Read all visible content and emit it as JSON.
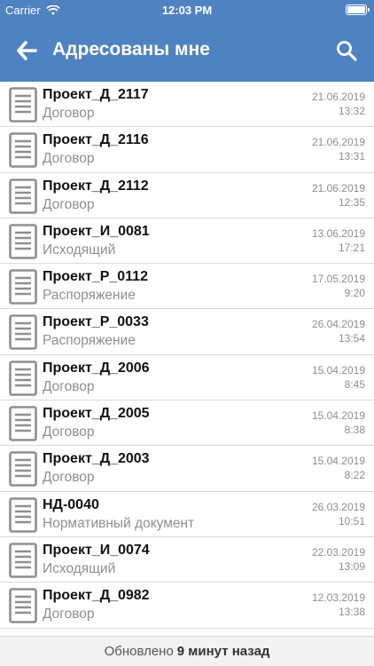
{
  "status_bar": {
    "carrier": "Carrier",
    "time": "12:03 PM",
    "wifi_icon": "wifi-icon",
    "battery_icon": "battery-icon"
  },
  "header": {
    "title": "Адресованы мне",
    "back_icon": "back-arrow-icon",
    "search_icon": "search-icon",
    "background": "#4f82c1"
  },
  "items": [
    {
      "title": "Проект_Д_2117",
      "subtitle": "Договор",
      "date": "21.06.2019",
      "time": "13:32"
    },
    {
      "title": "Проект_Д_2116",
      "subtitle": "Договор",
      "date": "21.06.2019",
      "time": "13:31"
    },
    {
      "title": "Проект_Д_2112",
      "subtitle": "Договор",
      "date": "21.06.2019",
      "time": "12:35"
    },
    {
      "title": "Проект_И_0081",
      "subtitle": "Исходящий",
      "date": "13.06.2019",
      "time": "17:21"
    },
    {
      "title": "Проект_Р_0112",
      "subtitle": "Распоряжение",
      "date": "17.05.2019",
      "time": "9:20"
    },
    {
      "title": "Проект_Р_0033",
      "subtitle": "Распоряжение",
      "date": "26.04.2019",
      "time": "13:54"
    },
    {
      "title": "Проект_Д_2006",
      "subtitle": "Договор",
      "date": "15.04.2019",
      "time": "8:45"
    },
    {
      "title": "Проект_Д_2005",
      "subtitle": "Договор",
      "date": "15.04.2019",
      "time": "8:38"
    },
    {
      "title": "Проект_Д_2003",
      "subtitle": "Договор",
      "date": "15.04.2019",
      "time": "8:22"
    },
    {
      "title": "НД-0040",
      "subtitle": "Нормативный документ",
      "date": "26.03.2019",
      "time": "10:51"
    },
    {
      "title": "Проект_И_0074",
      "subtitle": "Исходящий",
      "date": "22.03.2019",
      "time": "13:09"
    },
    {
      "title": "Проект_Д_0982",
      "subtitle": "Договор",
      "date": "12.03.2019",
      "time": "13:38"
    }
  ],
  "footer": {
    "prefix": "Обновлено",
    "ago": "9 минут назад"
  }
}
